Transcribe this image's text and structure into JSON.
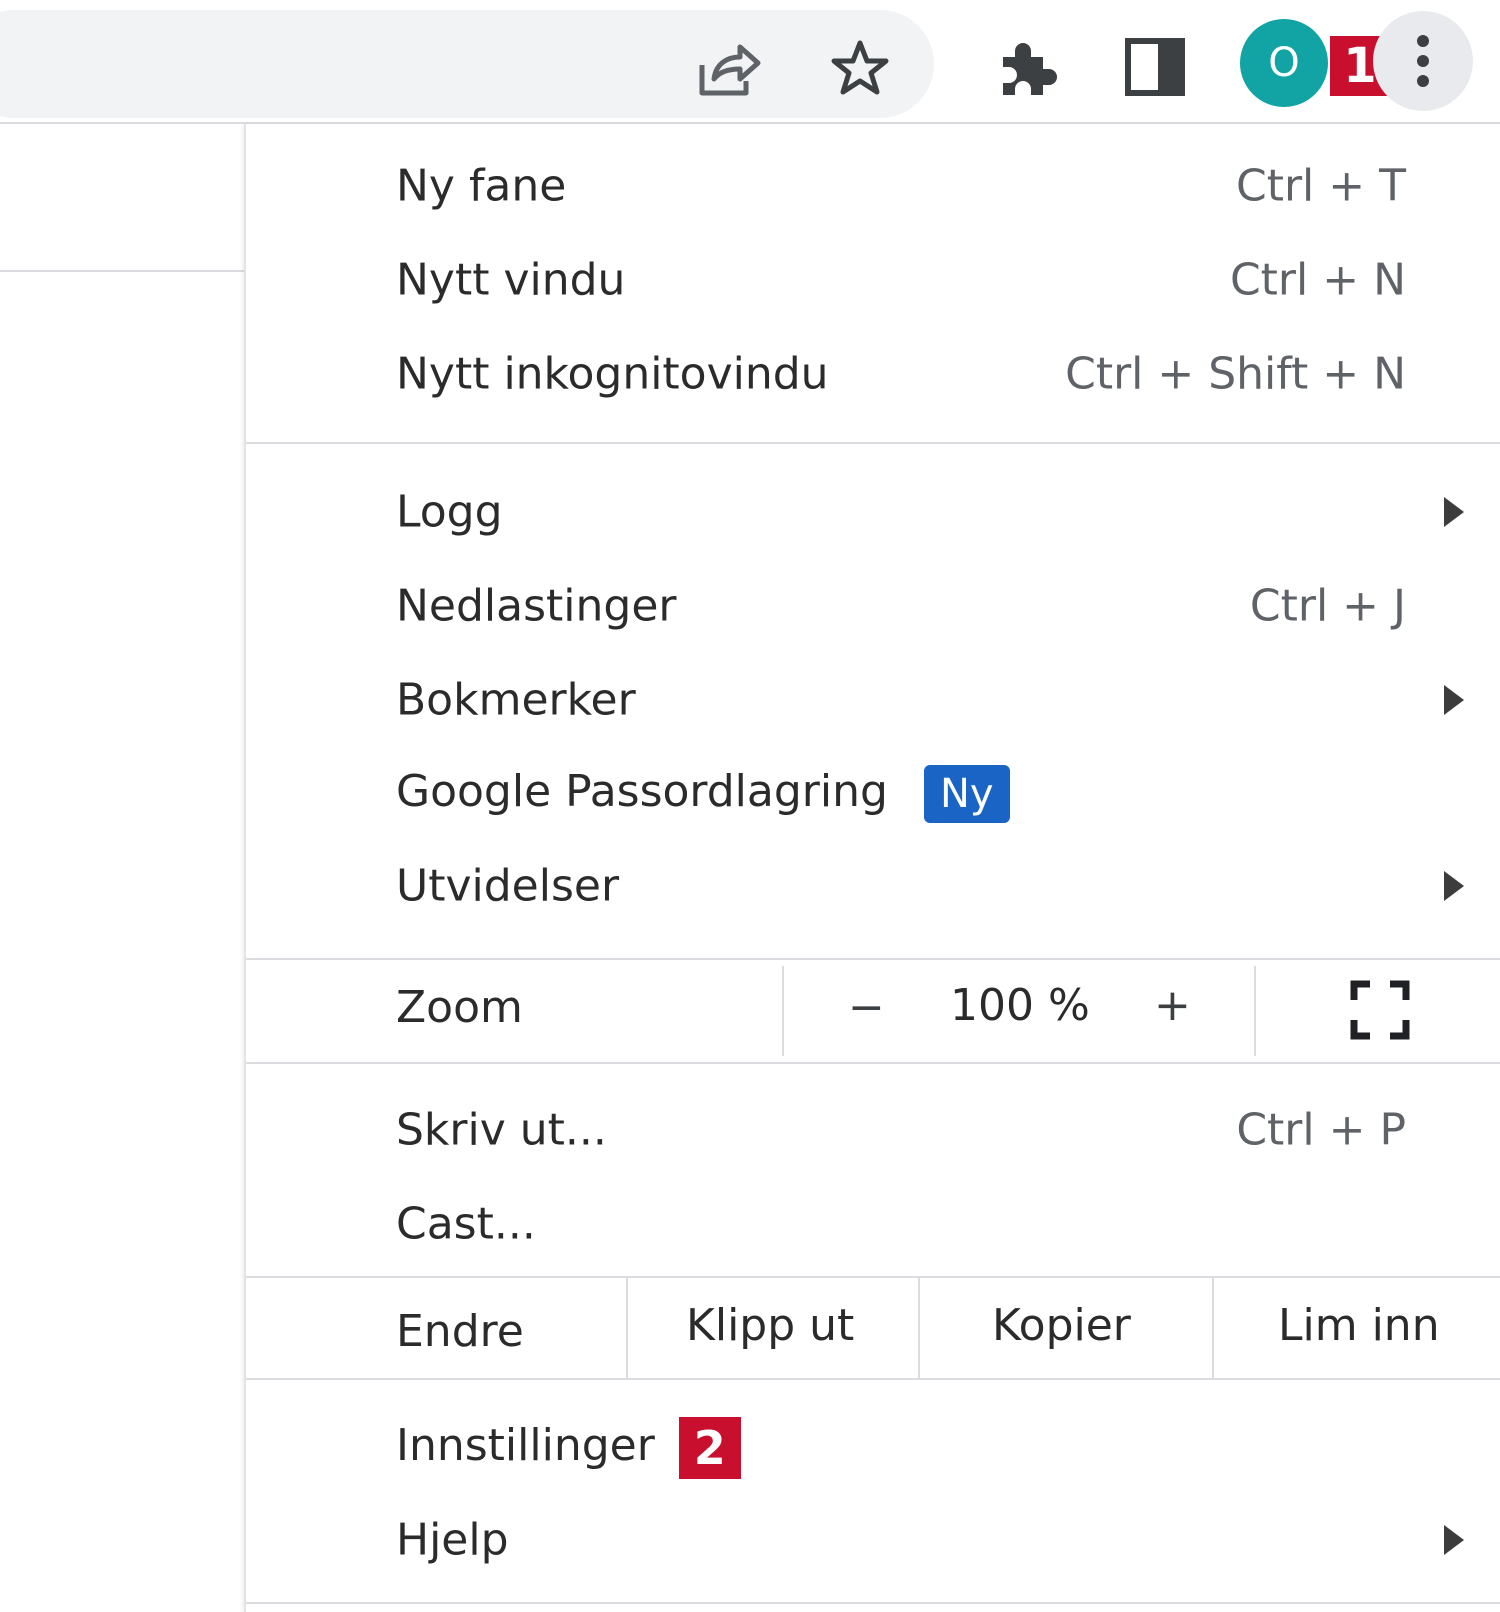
{
  "toolbar": {
    "share_icon": "share-icon",
    "bookmark_icon": "star-icon",
    "extensions_icon": "puzzle-icon",
    "sidepanel_icon": "side-panel-icon",
    "profile_initial": "O",
    "badge_1": "1",
    "menu_icon": "three-dots-icon"
  },
  "menu": {
    "new_tab": {
      "label": "Ny fane",
      "shortcut": "Ctrl + T"
    },
    "new_window": {
      "label": "Nytt vindu",
      "shortcut": "Ctrl + N"
    },
    "new_incognito": {
      "label": "Nytt inkognitovindu",
      "shortcut": "Ctrl + Shift + N"
    },
    "history": {
      "label": "Logg"
    },
    "downloads": {
      "label": "Nedlastinger",
      "shortcut": "Ctrl + J"
    },
    "bookmarks": {
      "label": "Bokmerker"
    },
    "password_manager": {
      "label": "Google Passordlagring",
      "badge": "Ny"
    },
    "extensions": {
      "label": "Utvidelser"
    },
    "zoom": {
      "label": "Zoom",
      "minus": "−",
      "value": "100 %",
      "plus": "+",
      "fullscreen_icon": "fullscreen-icon"
    },
    "print": {
      "label": "Skriv ut...",
      "shortcut": "Ctrl + P"
    },
    "cast": {
      "label": "Cast..."
    },
    "edit": {
      "label": "Endre",
      "cut": "Klipp ut",
      "copy": "Kopier",
      "paste": "Lim inn"
    },
    "settings": {
      "label": "Innstillinger",
      "badge_2": "2"
    },
    "help": {
      "label": "Hjelp"
    }
  },
  "colors": {
    "avatar": "#12a4a4",
    "callout_badge": "#c8102e",
    "new_badge": "#1a64c5"
  }
}
